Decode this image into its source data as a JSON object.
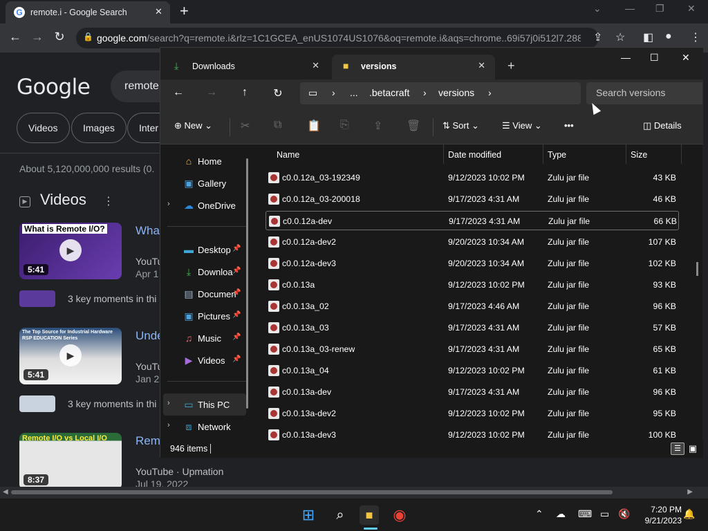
{
  "chrome": {
    "tab_title": "remote.i - Google Search",
    "tab_favicon": "G",
    "new_tab": "+",
    "url_domain": "google.com",
    "url_rest": "/search?q=remote.i&rlz=1C1GCEA_enUS1074US1076&oq=remote.i&aqs=chrome..69i57j0i512l7.288..."
  },
  "google": {
    "logo": "Google",
    "search_value": "remote",
    "chips": [
      "Videos",
      "Images",
      "Inter"
    ],
    "results_count": "About 5,120,000,000 results (0.",
    "videos_heading": "Videos",
    "videos": [
      {
        "thumb_caption": "What is Remote I/O?",
        "duration": "5:41",
        "title": "What",
        "source": "YouTu",
        "date": "Apr 1"
      },
      {
        "thumb_caption": "The Top Source for Industrial Hardware  RSP EDUCATION Series",
        "duration": "5:41",
        "title": "Unde",
        "source": "YouTu",
        "date": "Jan 2"
      },
      {
        "thumb_caption": "Remote I/O vs Local I/O",
        "duration": "8:37",
        "title": "Rem",
        "source": "YouTube · Upmation",
        "date": "Jul 19, 2022"
      }
    ],
    "key_moments": "3 key moments in thi"
  },
  "explorer": {
    "tabs": [
      {
        "label": "Downloads",
        "icon": "download-icon"
      },
      {
        "label": "versions",
        "icon": "folder-icon"
      }
    ],
    "breadcrumb": [
      "...",
      ".betacraft",
      "versions"
    ],
    "search_placeholder": "Search versions",
    "commands": {
      "new": "New",
      "sort": "Sort",
      "view": "View",
      "more": "•••",
      "details": "Details"
    },
    "sidebar": {
      "top": [
        "Home",
        "Gallery",
        "OneDrive"
      ],
      "pinned": [
        "Desktop",
        "Downloa",
        "Documen",
        "Pictures",
        "Music",
        "Videos"
      ],
      "bottom": [
        "This PC",
        "Network"
      ]
    },
    "columns": {
      "name": "Name",
      "date": "Date modified",
      "type": "Type",
      "size": "Size"
    },
    "files": [
      {
        "name": "c0.0.12a_03-192349",
        "date": "9/12/2023 10:02 PM",
        "type": "Zulu jar file",
        "size": "43 KB"
      },
      {
        "name": "c0.0.12a_03-200018",
        "date": "9/17/2023 4:31 AM",
        "type": "Zulu jar file",
        "size": "46 KB"
      },
      {
        "name": "c0.0.12a-dev",
        "date": "9/17/2023 4:31 AM",
        "type": "Zulu jar file",
        "size": "66 KB"
      },
      {
        "name": "c0.0.12a-dev2",
        "date": "9/20/2023 10:34 AM",
        "type": "Zulu jar file",
        "size": "107 KB"
      },
      {
        "name": "c0.0.12a-dev3",
        "date": "9/20/2023 10:34 AM",
        "type": "Zulu jar file",
        "size": "102 KB"
      },
      {
        "name": "c0.0.13a",
        "date": "9/12/2023 10:02 PM",
        "type": "Zulu jar file",
        "size": "93 KB"
      },
      {
        "name": "c0.0.13a_02",
        "date": "9/17/2023 4:46 AM",
        "type": "Zulu jar file",
        "size": "96 KB"
      },
      {
        "name": "c0.0.13a_03",
        "date": "9/17/2023 4:31 AM",
        "type": "Zulu jar file",
        "size": "57 KB"
      },
      {
        "name": "c0.0.13a_03-renew",
        "date": "9/17/2023 4:31 AM",
        "type": "Zulu jar file",
        "size": "65 KB"
      },
      {
        "name": "c0.0.13a_04",
        "date": "9/12/2023 10:02 PM",
        "type": "Zulu jar file",
        "size": "61 KB"
      },
      {
        "name": "c0.0.13a-dev",
        "date": "9/17/2023 4:31 AM",
        "type": "Zulu jar file",
        "size": "96 KB"
      },
      {
        "name": "c0.0.13a-dev2",
        "date": "9/12/2023 10:02 PM",
        "type": "Zulu jar file",
        "size": "95 KB"
      },
      {
        "name": "c0.0.13a-dev3",
        "date": "9/12/2023 10:02 PM",
        "type": "Zulu jar file",
        "size": "100 KB"
      }
    ],
    "status": "946 items"
  },
  "taskbar": {
    "time": "7:20 PM",
    "date": "9/21/2023"
  },
  "colors": {
    "accent": "#60cdff",
    "link": "#8ab4f8",
    "bg": "#202124"
  }
}
